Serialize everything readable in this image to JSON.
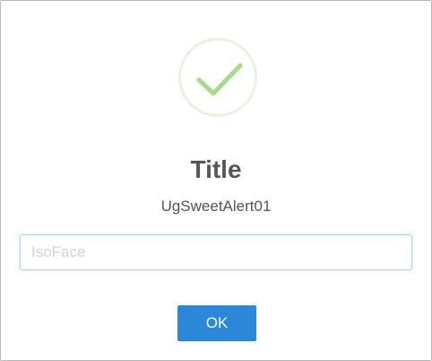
{
  "dialog": {
    "icon": "success-check-icon",
    "accent_color": "#a5dc86",
    "title": "Title",
    "text": "UgSweetAlert01",
    "input": {
      "value": "",
      "placeholder": "IsoFace"
    },
    "confirm_label": "OK",
    "confirm_color": "#2b87d8"
  }
}
